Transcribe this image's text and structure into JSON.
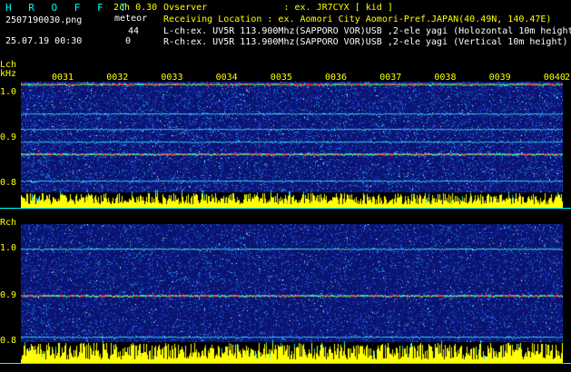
{
  "header": {
    "app_name": "H R O F F T",
    "mode": "2ch 0.30",
    "mode_label": "meteor",
    "filename": "2507190030.png",
    "datetime": "25.07.19 00:30",
    "count_l": "44",
    "count_r": "0",
    "observer": "Ovserver              : ex. JR7CYX [ kid ]",
    "location": "Receiving Location : ex. Aomori City Aomori-Pref.JAPAN(40.49N, 140.47E)",
    "lch_info": "L-ch:ex. UV5R 113.900Mhz(SAPPORO VOR)USB ,2-ele yagi (Holozontal 10m height",
    "rch_info": "R-ch:ex. UV5R 113.900Mhz(SAPPORO VOR)USB ,2-ele yagi (Vertical 10m height)"
  },
  "lch": {
    "label": "Lch",
    "unit": "kHz",
    "y_labels": [
      "1.0",
      "0.9",
      "0.8"
    ],
    "time_ticks": [
      "0031",
      "0032",
      "0033",
      "0034",
      "0035",
      "0036",
      "0037",
      "0038",
      "0039",
      "0040"
    ],
    "tail_tick": "2"
  },
  "rch": {
    "label": "Rch",
    "y_labels": [
      "1.0",
      "0.9",
      "0.8"
    ]
  },
  "colors": {
    "background": "#000000",
    "text_cyan": "#00ffff",
    "text_yellow": "#ffff00",
    "waterfall_base": "#0a1a8a",
    "level_bar": "#ffff00"
  }
}
